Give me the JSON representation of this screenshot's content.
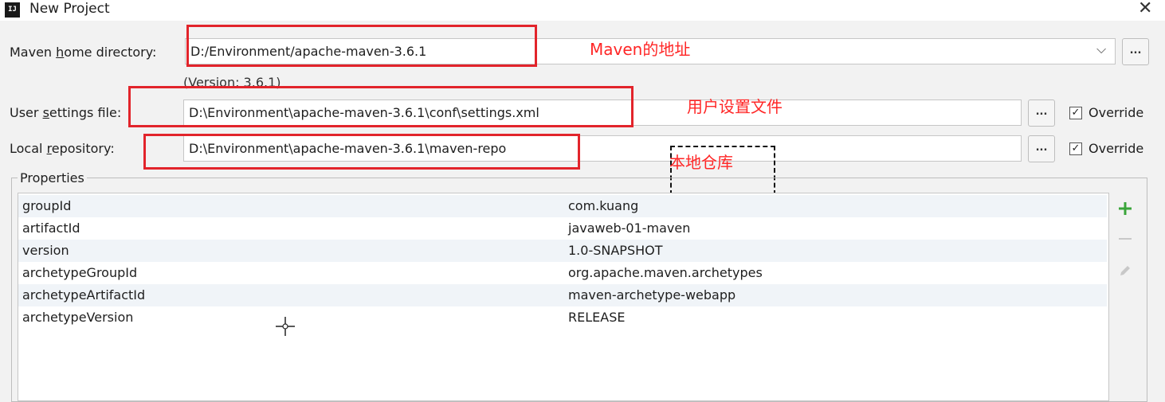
{
  "window": {
    "title": "New Project",
    "app_icon_text": "IJ",
    "close_glyph": "✕"
  },
  "maven_home": {
    "label_parts": [
      "Maven ",
      "h",
      "ome directory:"
    ],
    "value": "D:/Environment/apache-maven-3.6.1",
    "version": "(Version: 3.6.1)",
    "dropdown_glyph": "⌵",
    "browse_label": "..."
  },
  "user_settings": {
    "label_parts": [
      "User ",
      "s",
      "ettings file:"
    ],
    "value": "D:\\Environment\\apache-maven-3.6.1\\conf\\settings.xml",
    "browse_label": "...",
    "override_label": "Override",
    "override_checked": true
  },
  "local_repo": {
    "label_parts": [
      "Local ",
      "r",
      "epository:"
    ],
    "value": "D:\\Environment\\apache-maven-3.6.1\\maven-repo",
    "browse_label": "...",
    "override_label": "Override",
    "override_checked": true
  },
  "annotations": {
    "maven_home": "Maven的地址",
    "user_settings": "用户设置文件",
    "local_repo": "本地仓库",
    "color": "#ff2626"
  },
  "properties": {
    "title": "Properties",
    "rows": [
      {
        "key": "groupId",
        "value": "com.kuang"
      },
      {
        "key": "artifactId",
        "value": "javaweb-01-maven"
      },
      {
        "key": "version",
        "value": "1.0-SNAPSHOT"
      },
      {
        "key": "archetypeGroupId",
        "value": "org.apache.maven.archetypes"
      },
      {
        "key": "archetypeArtifactId",
        "value": "maven-archetype-webapp"
      },
      {
        "key": "archetypeVersion",
        "value": "RELEASE"
      }
    ],
    "toolbar": {
      "add_icon": "plus-icon",
      "remove_icon": "minus-icon",
      "edit_icon": "pencil-icon",
      "add_color": "#3aa53a"
    }
  }
}
